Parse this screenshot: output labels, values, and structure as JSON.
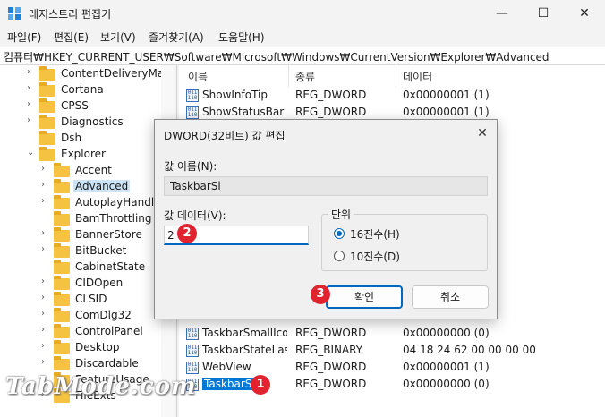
{
  "window": {
    "title": "레지스트리 편집기",
    "minimize_glyph": "—",
    "maximize_glyph": "☐",
    "close_glyph": "✕",
    "app_icon": "registry-editor-icon"
  },
  "menu": [
    "파일(F)",
    "편집(E)",
    "보기(V)",
    "즐겨찾기(A)",
    "도움말(H)"
  ],
  "address": "컴퓨터₩HKEY_CURRENT_USER₩Software₩Microsoft₩Windows₩CurrentVersion₩Explorer₩Advanced",
  "tree": [
    {
      "label": "ContentDeliveryMana",
      "chevron": "›"
    },
    {
      "label": "Cortana",
      "chevron": "›"
    },
    {
      "label": "CPSS",
      "chevron": "›"
    },
    {
      "label": "Diagnostics",
      "chevron": "›"
    },
    {
      "label": "Dsh",
      "chevron": ""
    },
    {
      "label": "Explorer",
      "chevron": "⌄"
    },
    {
      "label": "Accent",
      "chevron": "›"
    },
    {
      "label": "Advanced",
      "chevron": "›"
    },
    {
      "label": "AutoplayHandlers",
      "chevron": "›"
    },
    {
      "label": "BamThrottling",
      "chevron": ""
    },
    {
      "label": "BannerStore",
      "chevron": "›"
    },
    {
      "label": "BitBucket",
      "chevron": "›"
    },
    {
      "label": "CabinetState",
      "chevron": ""
    },
    {
      "label": "CIDOpen",
      "chevron": "›"
    },
    {
      "label": "CLSID",
      "chevron": "›"
    },
    {
      "label": "ComDlg32",
      "chevron": "›"
    },
    {
      "label": "ControlPanel",
      "chevron": "›"
    },
    {
      "label": "Desktop",
      "chevron": "›"
    },
    {
      "label": "Discardable",
      "chevron": "›"
    },
    {
      "label": "FeatureUsage",
      "chevron": "›"
    },
    {
      "label": "FileExts",
      "chevron": "›"
    }
  ],
  "list": {
    "headers": {
      "name": "이름",
      "type": "종류",
      "data": "데이터"
    },
    "rows_top": [
      {
        "name": "ShowInfoTip",
        "type": "REG_DWORD",
        "data": "0x00000001 (1)"
      },
      {
        "name": "ShowStatusBar",
        "type": "REG_DWORD",
        "data": "0x00000001 (1)"
      }
    ],
    "rows_bottom": [
      {
        "name": "TaskbarSmallIco...",
        "type": "REG_DWORD",
        "data": "0x00000000 (0)"
      },
      {
        "name": "TaskbarStateLas...",
        "type": "REG_BINARY",
        "data": "04 18 24 62 00 00 00 00"
      },
      {
        "name": "WebView",
        "type": "REG_DWORD",
        "data": "0x00000001 (1)"
      },
      {
        "name": "TaskbarSi",
        "type": "REG_DWORD",
        "data": "0x00000000 (0)"
      }
    ]
  },
  "dialog": {
    "title": "DWORD(32비트) 값 편집",
    "close_glyph": "✕",
    "name_label": "값 이름(N):",
    "name_value": "TaskbarSi",
    "data_label": "값 데이터(V):",
    "data_value": "2",
    "base_label": "단위",
    "radio_hex": "16진수(H)",
    "radio_dec": "10진수(D)",
    "ok": "확인",
    "cancel": "취소"
  },
  "steps": [
    "1",
    "2",
    "3"
  ],
  "watermark": "TabMode.com"
}
